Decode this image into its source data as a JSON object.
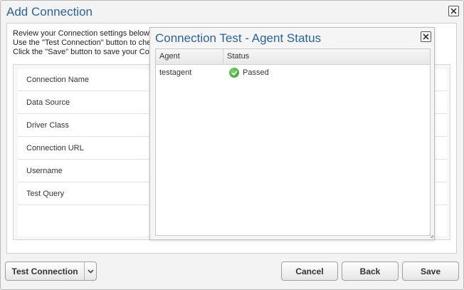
{
  "dialog": {
    "title": "Add Connection",
    "instructions": [
      "Review your Connection settings below.",
      "Use the \"Test Connection\" button to che",
      "Click the \"Save\" button to save your Co"
    ],
    "fields": [
      "Connection Name",
      "Data Source",
      "Driver Class",
      "Connection URL",
      "Username",
      "Test Query"
    ]
  },
  "modal": {
    "title": "Connection Test - Agent Status",
    "columns": [
      "Agent",
      "Status"
    ],
    "rows": [
      {
        "agent": "testagent",
        "status": "Passed",
        "status_icon": "check-circle-icon"
      }
    ]
  },
  "buttons": {
    "test_connection": "Test Connection",
    "cancel": "Cancel",
    "back": "Back",
    "save": "Save"
  },
  "colors": {
    "title": "#2a6496",
    "success": "#2f9a2a"
  }
}
